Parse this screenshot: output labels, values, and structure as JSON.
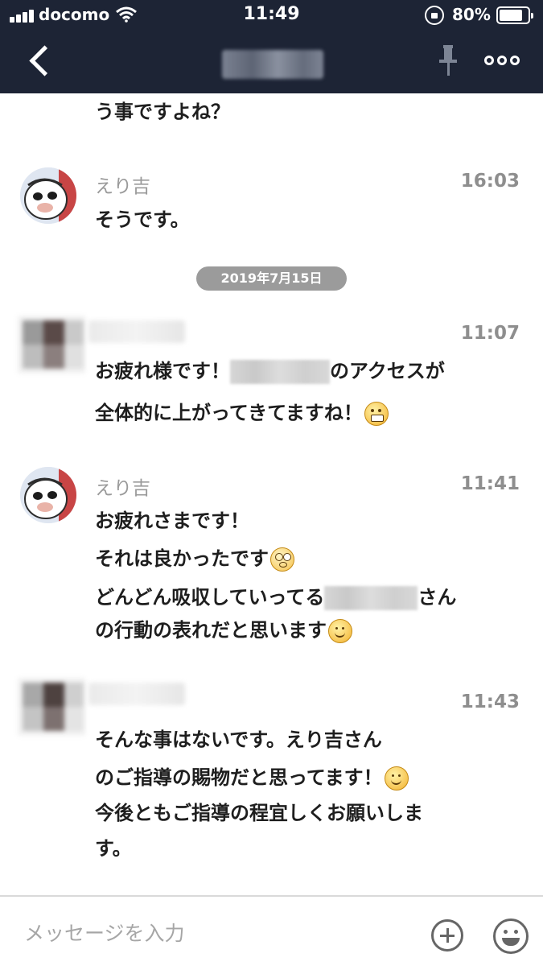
{
  "status_bar": {
    "carrier": "docomo",
    "time": "11:49",
    "battery": "80%"
  },
  "header": {
    "back_icon": "chevron-left-icon",
    "pin_icon": "pin-icon",
    "menu_icon": "more-dots-icon"
  },
  "messages": [
    {
      "lines": [
        "う事ですよね？"
      ]
    },
    {
      "sender": "えり吉",
      "time": "16:03",
      "lines": [
        "そうです。"
      ]
    },
    {
      "date_separator": "2019年7月15日"
    },
    {
      "time": "11:07",
      "line1_a": "お疲れ様です！",
      "line1_b": "のアクセスが",
      "line2": "全体的に上がってきてますね！"
    },
    {
      "sender": "えり吉",
      "time": "11:41",
      "line1": "お疲れさまです！",
      "line2": "それは良かったです",
      "line3_a": "どんどん吸収していってる",
      "line3_b": "さん",
      "line4": "の行動の表れだと思います"
    },
    {
      "time": "11:43",
      "line1": "そんな事はないです。えり吉さん",
      "line2": "のご指導の賜物だと思ってます！",
      "line3": "今後ともご指導の程宜しくお願いしま",
      "line4": "す。"
    }
  ],
  "input": {
    "placeholder": "メッセージを入力"
  },
  "colors": {
    "header_bg": "#1d2435",
    "date_pill_bg": "#9b9b9b",
    "time_text": "#8e8e8e"
  }
}
